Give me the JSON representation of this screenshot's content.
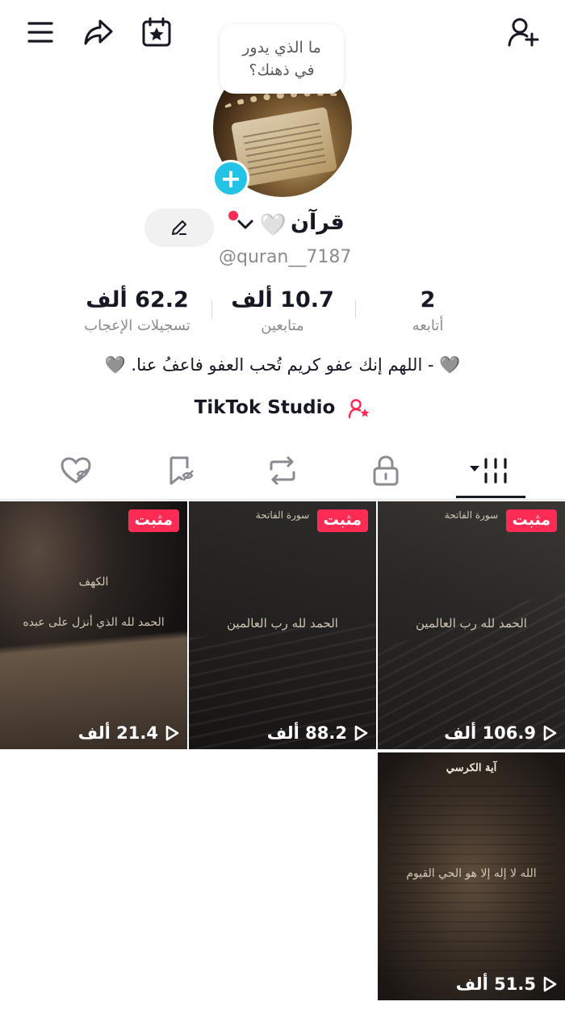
{
  "topbar": {
    "menu_icon": "hamburger-menu-icon",
    "share_icon": "share-arrow-icon",
    "calendar_icon": "calendar-star-icon",
    "add_friend_icon": "add-user-icon"
  },
  "profile": {
    "bubble_text": "ما الذي يدور\nفي ذهنك؟",
    "name": "قرآن",
    "name_emoji": "🤍",
    "handle": "@quran__7187",
    "bio": "🩶 - اللهم إنك عفو كريم تُحب العفو فاعفُ عنا. 🩶",
    "studio_label": "TikTok Studio"
  },
  "stats": [
    {
      "value": "2",
      "label": "أتابعه"
    },
    {
      "value": "10.7 ألف",
      "label": "متابعين"
    },
    {
      "value": "62.2 ألف",
      "label": "تسجيلات الإعجاب"
    }
  ],
  "tabs": [
    "videos-grid",
    "private-lock",
    "reposts",
    "favorites",
    "liked"
  ],
  "videos": [
    {
      "pinned": "مثبت",
      "views": "106.9 ألف",
      "top": "سورة الفاتحة",
      "line": "الحمد لله رب العالمين"
    },
    {
      "pinned": "مثبت",
      "views": "88.2 ألف",
      "top": "سورة الفاتحة",
      "line": "الحمد لله رب العالمين"
    },
    {
      "pinned": "مثبت",
      "views": "21.4 ألف",
      "top": "الكهف",
      "line": "الحمد لله الذي أنزل على عبده"
    },
    {
      "pinned": "",
      "views": "51.5 ألف",
      "top": "آية الكرسي",
      "line": "الله لا إله إلا هو الحي القيوم"
    }
  ],
  "colors": {
    "accent": "#fe2c55",
    "plus": "#22c3e6",
    "muted": "#8a8b91"
  }
}
